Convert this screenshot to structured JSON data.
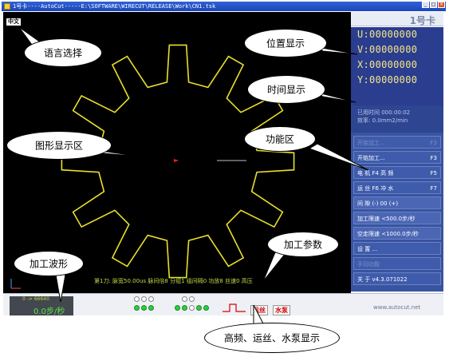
{
  "window": {
    "title": "1号卡----AutoCut-----E:\\SOFTWARE\\WIRECUT\\RELEASE\\Work\\CN1.tsk",
    "buttons": [
      "_",
      "□",
      "×"
    ]
  },
  "language": {
    "label": "中文"
  },
  "panel": {
    "logo": "1号卡",
    "coords": [
      "U:00000000",
      "V:00000000",
      "X:00000000",
      "Y:00000000"
    ],
    "time_label": "已用时间 000:00:02",
    "rate_label": "效率:   0.0mm2/min",
    "menu": [
      {
        "label": "开始加工...",
        "key": "F3",
        "dim": true
      },
      {
        "label": "开始加工...",
        "key": "F3"
      },
      {
        "label": "电  机   F4  高  频",
        "key": "F5"
      },
      {
        "label": "运  丝   F6  冲  水",
        "key": "F7"
      },
      {
        "label": "间  隙  (-) 00 (+)",
        "key": ""
      },
      {
        "label": "加工限速 <500.0步/秒",
        "key": ""
      },
      {
        "label": "空走限速 <1000.0步/秒",
        "key": ""
      },
      {
        "label": "设  置 ...",
        "key": ""
      },
      {
        "label": "手动功能",
        "key": "",
        "dim": true
      },
      {
        "label": "关  于  v4.3.071022",
        "key": ""
      }
    ]
  },
  "canvas": {
    "status_text": "第1刀: 脉宽50.00us 脉间倍8 分组1 组间隔0 功放8 丝速0 高压",
    "gear_color": "#e8e02a",
    "marker_color": "#ff2020"
  },
  "bottom": {
    "wave_top": "0 -> 66640",
    "wave_speed": "0.0步/秒",
    "tag_wire": "运丝",
    "tag_water": "水泵",
    "url": "www.autocut.net"
  },
  "callouts": {
    "language": "语言选择",
    "position": "位置显示",
    "time": "时间显示",
    "graphic": "图形显示区",
    "function": "功能区",
    "params": "加工参数",
    "wave": "加工波形",
    "status": "高频、运丝、水泵显示"
  }
}
